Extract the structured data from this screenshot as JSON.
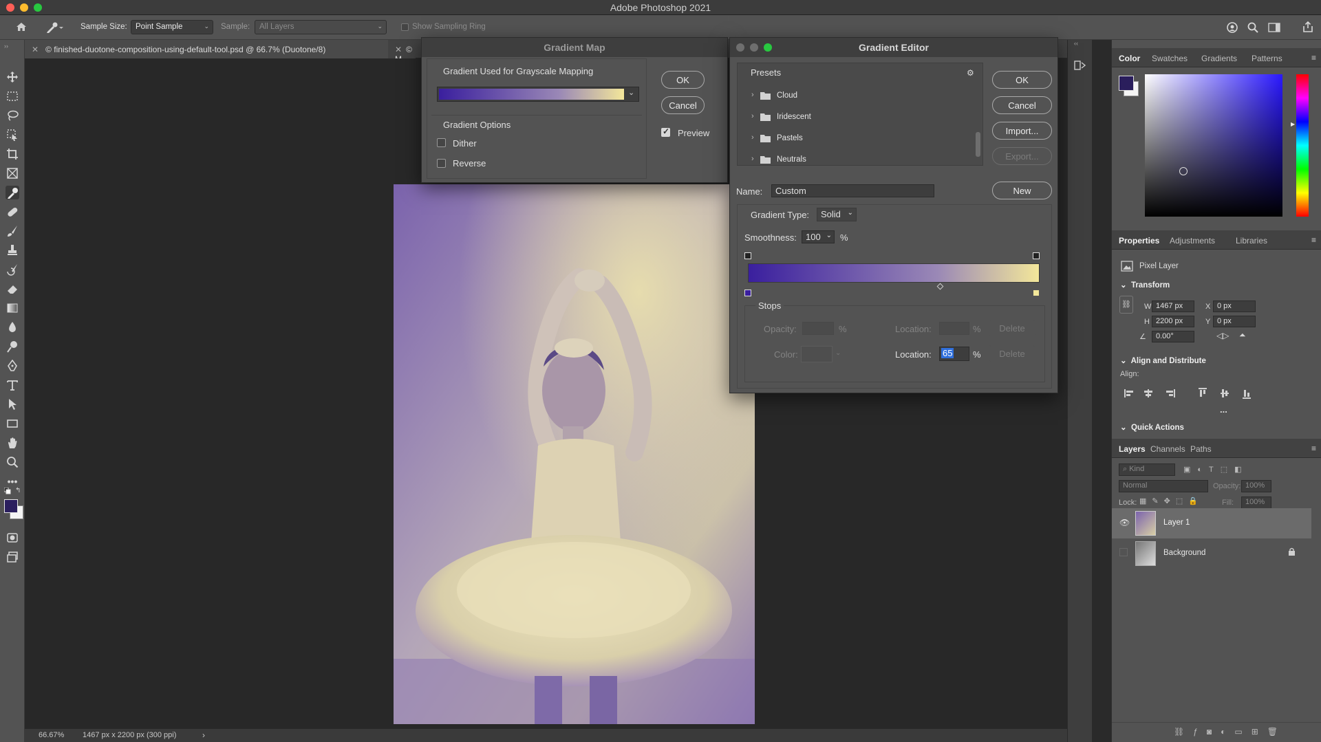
{
  "app": {
    "title": "Adobe Photoshop 2021"
  },
  "options_bar": {
    "sample_size_label": "Sample Size:",
    "sample_size_value": "Point Sample",
    "sample_label": "Sample:",
    "sample_value": "All Layers",
    "show_sampling_ring": "Show Sampling Ring"
  },
  "tabs": {
    "doc1": "© finished-duotone-composition-using-default-tool.psd @ 66.7% (Duotone/8)",
    "doc2": "© M"
  },
  "status": {
    "zoom": "66.67%",
    "info": "1467 px x 2200 px (300 ppi)"
  },
  "gradient_map": {
    "title": "Gradient Map",
    "section_label": "Gradient Used for Grayscale Mapping",
    "options_label": "Gradient Options",
    "dither": "Dither",
    "reverse": "Reverse",
    "ok": "OK",
    "cancel": "Cancel",
    "preview": "Preview",
    "preview_checked": true,
    "dither_checked": false,
    "reverse_checked": false
  },
  "gradient_editor": {
    "title": "Gradient Editor",
    "presets_label": "Presets",
    "presets": [
      "Cloud",
      "Iridescent",
      "Pastels",
      "Neutrals"
    ],
    "ok": "OK",
    "cancel": "Cancel",
    "import": "Import...",
    "export": "Export...",
    "name_label": "Name:",
    "name_value": "Custom",
    "new": "New",
    "gradient_type_label": "Gradient Type:",
    "gradient_type_value": "Solid",
    "smoothness_label": "Smoothness:",
    "smoothness_value": "100",
    "percent": "%",
    "stops_label": "Stops",
    "opacity_label": "Opacity:",
    "color_label": "Color:",
    "location_label": "Location:",
    "location_value": "65",
    "delete": "Delete",
    "colors": {
      "start": "#3a1f9e",
      "mid": "#9a88b6",
      "end": "#f3e79a"
    }
  },
  "color_panel": {
    "tabs": [
      "Color",
      "Swatches",
      "Gradients",
      "Patterns"
    ]
  },
  "properties_panel": {
    "tabs": [
      "Properties",
      "Adjustments",
      "Libraries"
    ],
    "layer_type": "Pixel Layer",
    "transform_label": "Transform",
    "w_label": "W",
    "w_value": "1467 px",
    "h_label": "H",
    "h_value": "2200 px",
    "x_label": "X",
    "x_value": "0 px",
    "y_label": "Y",
    "y_value": "0 px",
    "angle_value": "0.00°",
    "align_distribute_label": "Align and Distribute",
    "align_label": "Align:",
    "more": "...",
    "quick_actions_label": "Quick Actions"
  },
  "layers_panel": {
    "tabs": [
      "Layers",
      "Channels",
      "Paths"
    ],
    "kind_placeholder": "Kind",
    "blend_mode": "Normal",
    "opacity_label": "Opacity:",
    "opacity_value": "100%",
    "lock_label": "Lock:",
    "fill_label": "Fill:",
    "fill_value": "100%",
    "layers": [
      {
        "name": "Layer 1",
        "visible": true,
        "selected": true
      },
      {
        "name": "Background",
        "visible": false,
        "locked": true
      }
    ]
  }
}
